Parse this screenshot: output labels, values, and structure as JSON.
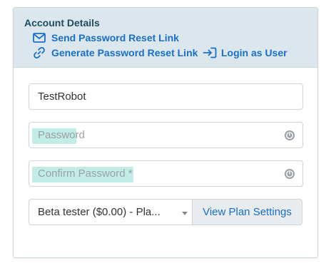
{
  "account_details": {
    "title": "Account Details",
    "links": {
      "send_reset": "Send Password Reset Link",
      "generate_reset": "Generate Password Reset Link",
      "login_as_user": "Login as User"
    }
  },
  "form": {
    "username_value": "TestRobot",
    "password_placeholder": "Password",
    "confirm_password_placeholder": "Confirm Password *",
    "plan_selected": "Beta tester ($0.00) - Pla...",
    "view_plan_settings": "View Plan Settings"
  },
  "icons": {
    "send_reset": "envelope-icon",
    "generate_reset": "link-icon",
    "login_as_user": "sign-in-icon",
    "password_reveal": "password-reveal-icon",
    "confirm_reveal": "password-reveal-icon"
  },
  "colors": {
    "header_bg": "#dbe7ec",
    "link": "#1a6fc4",
    "title": "#1e4b5e",
    "highlight": "#b7eadf"
  }
}
